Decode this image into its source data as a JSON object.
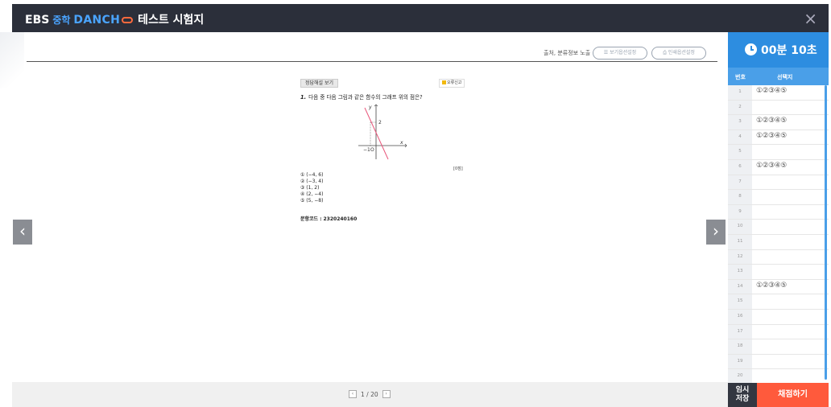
{
  "header": {
    "brand_ebs": "EBS",
    "brand_mid": "중학",
    "brand_danchoo": "DANCH",
    "title": "테스트 시험지",
    "close_label": "×"
  },
  "toolbar": {
    "source_label": "출처, 분류정보 노출",
    "view_setting": "보기옵션설정",
    "print_setting": "인쇄옵션설정"
  },
  "question": {
    "answer_button": "정답해설 보기",
    "report_button": "오류신고",
    "number": "1.",
    "text": "다음 중 다음 그림과 같은 함수의 그래프 위의 점은?",
    "score": "[0점]",
    "choices": [
      "① (−4, 6)",
      "② (−3, 4)",
      "③ (1, 2)",
      "④ (2, −4)",
      "⑤ (5, −8)"
    ],
    "code_label": "문항코드 :",
    "code_value": "2320240160",
    "graph": {
      "y_label": "y",
      "x_label": "x",
      "y_tick": "2",
      "x_tick": "−1",
      "origin": "O"
    }
  },
  "nav": {
    "prev": "‹",
    "next": "›"
  },
  "pager": {
    "prev": "‹",
    "current": "1 / 20",
    "next": "›"
  },
  "panel": {
    "timer": "00분 10초",
    "col_number": "번호",
    "col_choice": "선택지",
    "rows": [
      {
        "n": "1",
        "choices": "①②③④⑤"
      },
      {
        "n": "2",
        "choices": ""
      },
      {
        "n": "3",
        "choices": "①②③④⑤"
      },
      {
        "n": "4",
        "choices": "①②③④⑤"
      },
      {
        "n": "5",
        "choices": ""
      },
      {
        "n": "6",
        "choices": "①②③④⑤"
      },
      {
        "n": "7",
        "choices": ""
      },
      {
        "n": "8",
        "choices": ""
      },
      {
        "n": "9",
        "choices": ""
      },
      {
        "n": "10",
        "choices": ""
      },
      {
        "n": "11",
        "choices": ""
      },
      {
        "n": "12",
        "choices": ""
      },
      {
        "n": "13",
        "choices": ""
      },
      {
        "n": "14",
        "choices": "①②③④⑤"
      },
      {
        "n": "15",
        "choices": ""
      },
      {
        "n": "16",
        "choices": ""
      },
      {
        "n": "17",
        "choices": ""
      },
      {
        "n": "18",
        "choices": ""
      },
      {
        "n": "19",
        "choices": ""
      },
      {
        "n": "20",
        "choices": ""
      }
    ],
    "save_button": "임시\n저장",
    "grade_button": "채점하기"
  },
  "colors": {
    "header_bg": "#2b2f3a",
    "accent_blue": "#2d8de0",
    "grade_orange": "#ff5a3c",
    "graph_line": "#e8567a"
  }
}
